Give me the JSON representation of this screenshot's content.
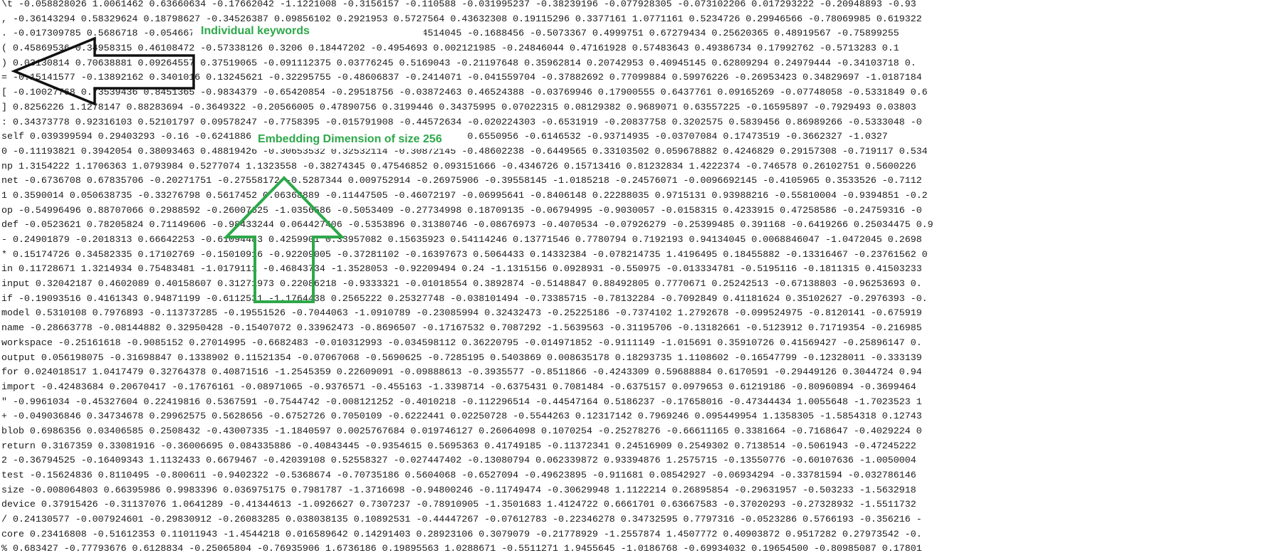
{
  "editor": {
    "lines": [
      "\\t -0.058828026 1.0061462 0.63660634 -0.17662042 -1.1221008 -0.3156157 -0.110588 -0.031995237 -0.38239196 -0.077928305 -0.073102206 0.017293222 -0.20948893 -0.93",
      ", -0.36143294 0.58329624 0.18798627 -0.34526387 0.09856102 0.2921953 0.5727564 0.43632308 0.19115296 0.3377161 1.0771161 0.5234726 0.29946566 -0.78069985 0.619322",
      ". -0.017309785 0.5686718 -0.05466784 -0.31498426 0.620094 -0.86646956 -0.54514045 -0.1688456 -0.5073367 0.4999751 0.67279434 0.25620365 0.48919567 -0.75899255",
      "( 0.45869536 0.34958315 0.46108472 -0.57338126 0.3206 0.18447202 -0.4954693 0.002121985 -0.24846044 0.47161928 0.57483643 0.49386734 0.17992762 -0.5713283 0.1",
      ") 0.03130814 0.70638881 0.09264557 0.37519065 -0.091112375 0.03776245 0.5169043 -0.21197648 0.35962814 0.20742953 0.40945145 0.62809294 0.24979444 -0.34103718 0.",
      "= -0.15141577 -0.13892162 0.3401016 0.13245621 -0.32295755 -0.48606837 -0.2414071 -0.041559704 -0.37882692 0.77099884 0.59976226 -0.26953423 0.34829697 -1.0187184",
      "[ -0.10027768 0.73539436 0.8451365 -0.9834379 -0.65420854 -0.29518756 -0.03872463 0.46524388 -0.03769946 0.17900555 0.6437761 0.09165269 -0.07748058 -0.5331849 0.6",
      "] 0.8256226 1.1278147 0.88283694 -0.3649322 -0.20566005 0.47890756 0.3199446 0.34375995 0.07022315 0.08129382 0.9689071 0.63557225 -0.16595897 -0.7929493 0.03803",
      ": 0.34373778 0.92316103 0.52101797 0.09578247 -0.7758395 -0.015791908 -0.44572634 -0.020224303 -0.6531919 -0.20837758 0.3202575 0.5839456 0.86989266 -0.5333048 -0",
      "self 0.039399594 0.29403293 -0.16 -0.62418862 0.63910377 -0.123840496 0.045921557 0.6550956 -0.6146532 -0.93714935 -0.03707084 0.17473519 -0.3662327 -1.0327",
      "0 -0.11193821 0.3942054 0.38093463 0.48819426 -0.30653532 0.32532114 -0.30872145 -0.48602238 -0.6449565 0.33103502 0.059678882 0.4246829 0.29157308 -0.719117 0.534",
      "np 1.3154222 1.1706363 1.0793984 0.5277074 1.1323558 -0.38274345 0.47546852 0.093151666 -0.4346726 0.15713416 0.81232834 1.4222374 -0.746578 0.26102751 0.5600226",
      "net -0.6736708 0.67835706 -0.20271751 -0.27558172 -0.5287344 0.009752914 -0.26975906 -0.39558145 -1.0185218 -0.24576071 -0.0096692145 -0.4105965 0.3533526 -0.7112",
      "1 0.3590014 0.050638735 -0.33276798 0.5617452 0.06368889 -0.11447505 -0.46072197 -0.06995641 -0.8406148 0.22288035 0.9715131 0.93988216 -0.55810004 -0.9394851 -0.2",
      "op -0.54996496 0.88707066 0.2988592 -0.26007625 -1.0356586 -0.5053409 -0.27734998 0.18709135 -0.06794995 -0.9030057 -0.0158315 0.4233915 0.47258586 -0.24759316 -0",
      "def -0.0523621 0.78205824 0.71149606 -0.98433244 0.064427406 -0.5353896 0.31380746 -0.08676973 -0.4070534 -0.07926279 -0.25399485 0.391168 -0.6419266 0.25034475 0.9",
      "- 0.24901879 -0.2018313 0.66642253 -0.61094483 0.4259901 0.33957082 0.15635923 0.54114246 0.13771546 0.7780794 0.7192193 0.94134045 0.0068846047 -1.0472045 0.2698",
      "* 0.15174726 0.34582335 0.17102769 -0.15010916 -0.92209005 -0.37281102 -0.16397673 0.5064433 0.14332384 -0.078214735 1.4196495 0.18455882 -0.13316467 -0.23761562 0",
      "in 0.11728671 1.3214934 0.75483481 -1.0179111 -0.46843734 -1.3528053 -0.92209494 0.24 -1.1315156 0.0928931 -0.550975 -0.013334781 -0.5195116 -0.1811315 0.41503233",
      "input 0.32042187 0.4602089 0.40158607 0.31271973 0.22086218 -0.9333321 -0.01018554 0.3892874 -0.5148847 0.88492805 0.7770671 0.25242513 -0.67138803 -0.96253693 0.",
      "if -0.19093516 0.4161343 0.94871199 -0.6112531 -1.1764438 0.2565222 0.25327748 -0.038101494 -0.73385715 -0.78132284 -0.7092849 0.41181624 0.35102627 -0.2976393 -0.",
      "model 0.5310108 0.7976893 -0.113737285 -0.19551526 -0.7044063 -1.0910789 -0.23085994 0.32432473 -0.25225186 -0.7374102 1.2792678 -0.099524975 -0.8120141 -0.675919",
      "name -0.28663778 -0.08144882 0.32950428 -0.15407072 0.33962473 -0.8696507 -0.17167532 0.7087292 -1.5639563 -0.31195706 -0.13182661 -0.5123912 0.71719354 -0.216985",
      "workspace -0.25161618 -0.9085152 0.27014995 -0.6682483 -0.010312993 -0.034598112 0.36220795 -0.014971852 -0.9111149 -1.015691 0.35910726 0.41569427 -0.25896147 0.",
      "output 0.056198075 -0.31698847 0.1338902 0.11521354 -0.07067068 -0.5690625 -0.7285195 0.5403869 0.008635178 0.18293735 1.1108602 -0.16547799 -0.12328011 -0.333139",
      "for 0.024018517 1.0417479 0.32764378 0.40871516 -1.2545359 0.22609091 -0.09888613 -0.3935577 -0.8511866 -0.4243309 0.59688884 0.6170591 -0.29449126 0.3044724 0.94",
      "import -0.42483684 0.20670417 -0.17676161 -0.08971065 -0.9376571 -0.455163 -1.3398714 -0.6375431 0.7081484 -0.6375157 0.0979653 0.61219186 -0.80960894 -0.3699464",
      "\" -0.9961034 -0.45327604 0.22419816 0.5367591 -0.7544742 -0.008121252 -0.4010218 -0.112296514 -0.44547164 0.5186237 -0.17658016 -0.47344434 1.0055648 -1.7023523 1",
      "+ -0.049036846 0.34734678 0.29962575 0.5628656 -0.6752726 0.7050109 -0.6222441 0.02250728 -0.5544263 0.12317142 0.7969246 0.095449954 1.1358305 -1.5854318 0.12743",
      "blob 0.6986356 0.03406585 0.2508432 -0.43007335 -1.1840597 0.0025767684 0.019746127 0.26064098 0.1070254 -0.25278276 -0.66611165 0.3381664 -0.7168647 -0.4029224 0",
      "return 0.3167359 0.33081916 -0.36006695 0.084335886 -0.40843445 -0.9354615 0.5695363 0.41749185 -0.11372341 0.24516909 0.2549302 0.7138514 -0.5061943 -0.47245222",
      "2 -0.36794525 -0.16409343 1.1132433 0.6679467 -0.42039108 0.52558327 -0.027447402 -0.13080794 0.062339872 0.93394876 1.2575715 -0.13550776 -0.60107636 -1.0050004",
      "test -0.15624836 0.8110495 -0.800611 -0.9402322 -0.5368674 -0.70735186 0.5604068 -0.6527094 -0.49623895 -0.911681 0.08542927 -0.06934294 -0.33781594 -0.032786146",
      "size -0.008064803 0.66395986 0.9983396 0.036975175 0.7981787 -1.3716698 -0.94800246 -0.11749474 -0.30629948 1.1122214 0.26895854 -0.29631957 -0.503233 -1.5632918",
      "device 0.37915426 -0.31137076 1.0641289 -0.41344613 -1.0926627 0.7307237 -0.78910905 -1.3501683 1.4124722 0.6661701 0.63667583 -0.37020293 -0.27328932 -1.5511732",
      "/ 0.24130577 -0.007924601 -0.29830912 -0.26083285 0.038038135 0.10892531 -0.44447267 -0.07612783 -0.22346278 0.34732595 0.7797316 -0.0523286 0.5766193 -0.356216 -",
      "core 0.23416808 -0.51612353 0.11011943 -1.4544218 0.016589642 0.14291403 0.28923106 0.3079079 -0.21778929 -1.2557874 1.4507772 0.40903872 0.9517282 0.27973542 -0.",
      "% 0.683427 -0.77793676 0.6128834 -0.25065804 -0.76935906 1.6736186 0.19895563 1.0288671 -0.5511271 1.9455645 -1.0186768 -0.69934032 0.19654500 -0.80985087 0.17801"
    ]
  },
  "annotations": {
    "keywords_label": "Individual keywords",
    "embedding_label": "Embedding Dimension of size 256",
    "black_arrow_color": "#111111",
    "green_color": "#2ea84a",
    "black_arrow_icon": "left-arrow-icon",
    "green_arrow_icon": "up-arrow-icon"
  }
}
